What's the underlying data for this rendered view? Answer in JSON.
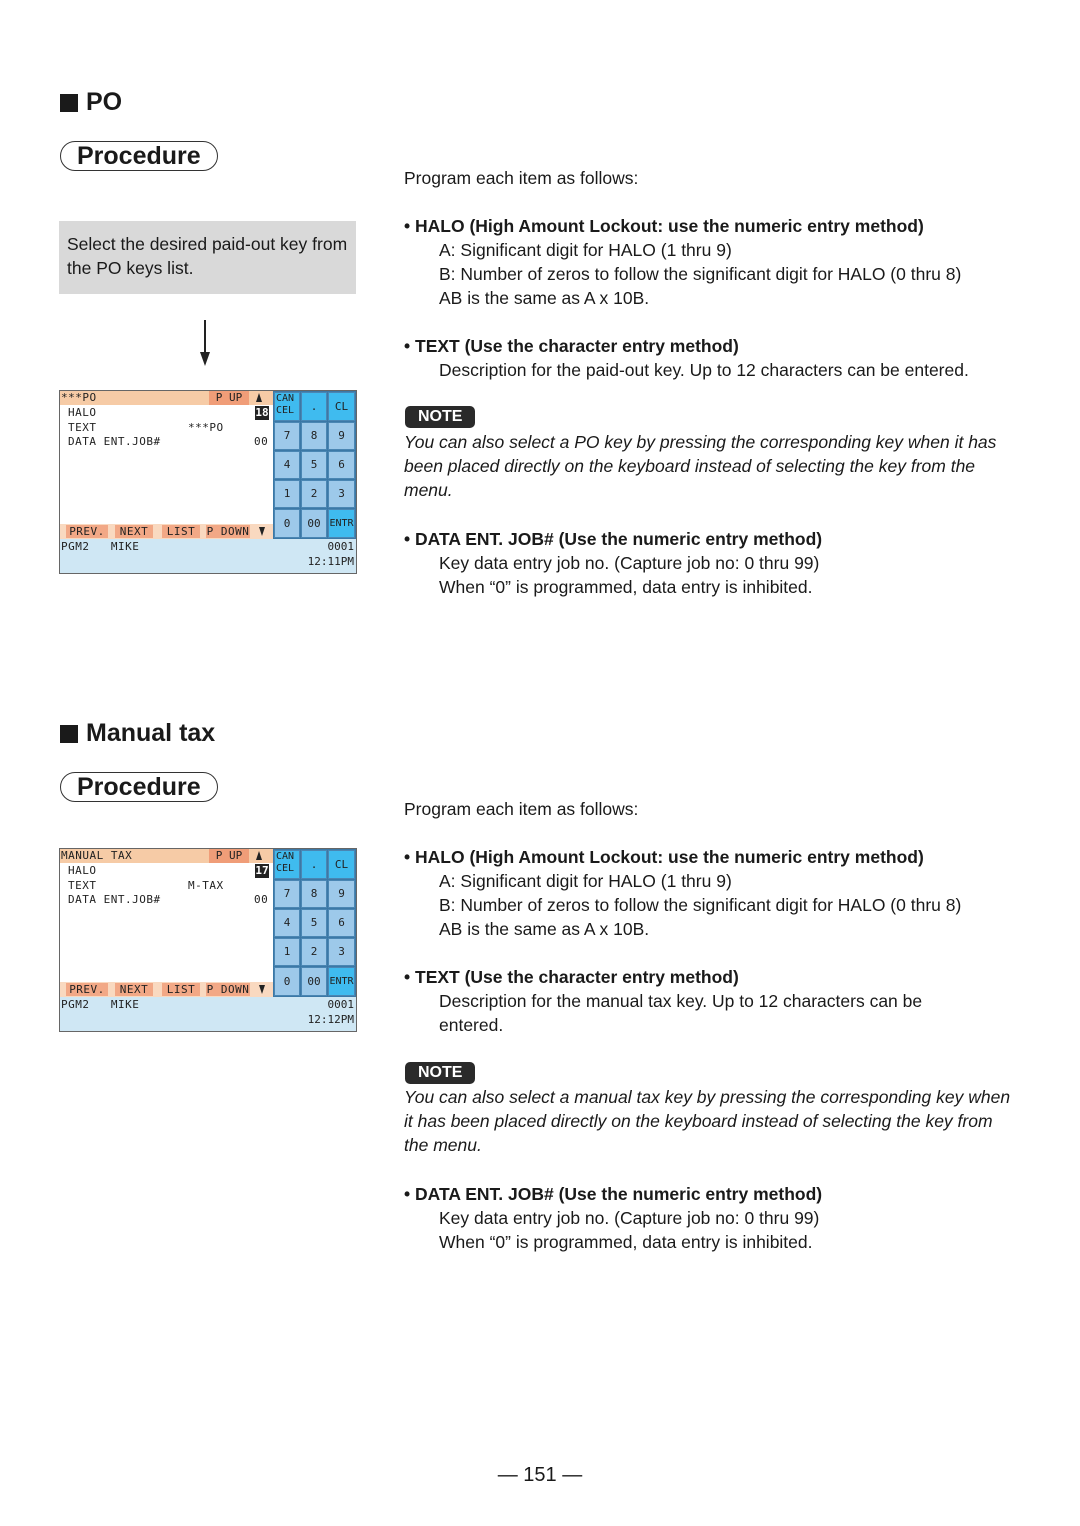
{
  "sections": [
    {
      "title": "PO",
      "procedure_label": "Procedure",
      "step_text": "Select the desired paid-out key from the PO keys list.",
      "intro": "Program each item as follows:",
      "items": [
        {
          "heading": "HALO (High Amount Lockout: use the numeric entry method)",
          "lines": [
            "A: Significant digit for HALO (1 thru 9)",
            "B: Number of zeros to follow the significant digit for HALO (0 thru 8)",
            "AB is the same as A x 10B."
          ]
        },
        {
          "heading": "TEXT (Use the character entry method)",
          "lines": [
            "Description for the paid-out key. Up to 12 characters can be entered."
          ]
        },
        {
          "heading": "DATA ENT. JOB# (Use the numeric entry method)",
          "lines": [
            "Key data entry job no. (Capture job no: 0 thru 99)",
            "When “0” is programmed, data entry is inhibited."
          ]
        }
      ],
      "note_label": "NOTE",
      "note_text": "You can also select a PO key by pressing the corresponding key when it has been placed directly on the keyboard instead of selecting the key from the menu.",
      "screen": {
        "title": "***PO",
        "pup": "P UP",
        "rows": [
          {
            "label": "HALO",
            "value": "18"
          },
          {
            "label": "TEXT",
            "value": "***PO"
          },
          {
            "label": "DATA ENT.JOB#",
            "value": "00"
          }
        ],
        "bottom_buttons": [
          "PREV.",
          "NEXT",
          "LIST",
          "P DOWN"
        ],
        "status_left": "PGM2   MIKE",
        "status_code": "0001",
        "status_time": "12:11PM"
      }
    },
    {
      "title": "Manual tax",
      "procedure_label": "Procedure",
      "intro": "Program each item as follows:",
      "items": [
        {
          "heading": "HALO (High Amount Lockout: use the numeric entry method)",
          "lines": [
            "A: Significant digit for HALO (1 thru 9)",
            "B: Number of zeros to follow the significant digit for HALO (0 thru 8)",
            "AB is the same as A x 10B."
          ]
        },
        {
          "heading": "TEXT (Use the character entry method)",
          "lines": [
            "Description for the manual tax key. Up to 12 characters can be",
            "entered."
          ]
        },
        {
          "heading": "DATA ENT. JOB# (Use the numeric entry method)",
          "lines": [
            "Key data entry job no. (Capture job no: 0 thru 99)",
            "When “0” is programmed, data entry is inhibited."
          ]
        }
      ],
      "note_label": "NOTE",
      "note_text": "You can also select a manual tax key by pressing the corresponding key when it has been placed directly on the keyboard instead of selecting the key from the menu.",
      "screen": {
        "title": "MANUAL TAX",
        "pup": "P UP",
        "rows": [
          {
            "label": "HALO",
            "value": "17"
          },
          {
            "label": "TEXT",
            "value": "M-TAX"
          },
          {
            "label": "DATA ENT.JOB#",
            "value": "00"
          }
        ],
        "bottom_buttons": [
          "PREV.",
          "NEXT",
          "LIST",
          "P DOWN"
        ],
        "status_left": "PGM2   MIKE",
        "status_code": "0001",
        "status_time": "12:12PM"
      }
    }
  ],
  "keypad": {
    "keys": [
      "CAN\nCEL",
      ".",
      "CL",
      "7",
      "8",
      "9",
      "4",
      "5",
      "6",
      "1",
      "2",
      "3",
      "0",
      "00",
      "ENTR"
    ]
  },
  "page_number": "— 151 —"
}
